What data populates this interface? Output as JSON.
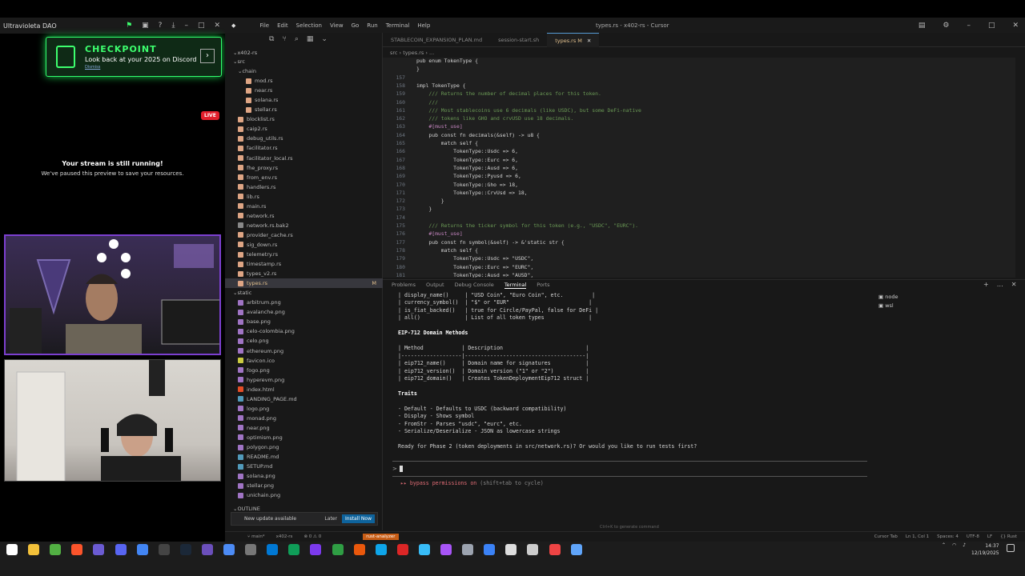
{
  "stream": {
    "window_title": "Ultravioleta DAO",
    "banner_title": "CHECKPOINT",
    "banner_text": "Look back at your 2025 on Discord",
    "banner_dismiss": "Dismiss",
    "live": "LIVE",
    "paused_title": "Your stream is still running!",
    "paused_sub": "We've paused this preview to save your resources."
  },
  "editor": {
    "title": "types.rs - x402-rs - Cursor",
    "menu": [
      "File",
      "Edit",
      "Selection",
      "View",
      "Go",
      "Run",
      "Terminal",
      "Help"
    ],
    "tabs": [
      "STABLECOIN_EXPANSION_PLAN.md",
      "session-start.sh",
      "types.rs M"
    ],
    "breadcrumb": "src  ›  types.rs  ›  ..."
  },
  "explorer": {
    "root": "x402-rs",
    "src": "src",
    "chain": "chain",
    "chain_files": [
      "mod.rs",
      "near.rs",
      "solana.rs",
      "stellar.rs"
    ],
    "files": [
      "blocklist.rs",
      "caip2.rs",
      "debug_utils.rs",
      "facilitator.rs",
      "facilitator_local.rs",
      "fhe_proxy.rs",
      "from_env.rs",
      "handlers.rs",
      "lib.rs",
      "main.rs",
      "network.rs",
      "network.rs.bak2",
      "provider_cache.rs",
      "sig_down.rs",
      "telemetry.rs",
      "timestamp.rs",
      "types_v2.rs",
      "types.rs"
    ],
    "static": "static",
    "static_files": [
      "arbitrum.png",
      "avalanche.png",
      "base.png",
      "celo-colombia.png",
      "celo.png",
      "ethereum.png",
      "favicon.ico",
      "fogo.png",
      "hyperevm.png",
      "index.html",
      "LANDING_PAGE.md",
      "logo.png",
      "monad.png",
      "near.png",
      "optimism.png",
      "polygon.png",
      "README.md",
      "SETUP.md",
      "solana.png",
      "stellar.png",
      "unichain.png"
    ],
    "outline": "OUTLINE",
    "modified_mark": "M"
  },
  "code": {
    "lines": [
      {
        "n": "",
        "t": "pub enum TokenType {"
      },
      {
        "n": "",
        "t": "}"
      },
      {
        "n": "157",
        "t": ""
      },
      {
        "n": "158",
        "t": "impl TokenType {"
      },
      {
        "n": "159",
        "t": "    /// Returns the number of decimal places for this token."
      },
      {
        "n": "160",
        "t": "    ///"
      },
      {
        "n": "161",
        "t": "    /// Most stablecoins use 6 decimals (like USDC), but some DeFi-native"
      },
      {
        "n": "162",
        "t": "    /// tokens like GHO and crvUSD use 18 decimals."
      },
      {
        "n": "163",
        "t": "    #[must_use]"
      },
      {
        "n": "164",
        "t": "    pub const fn decimals(&self) -> u8 {"
      },
      {
        "n": "165",
        "t": "        match self {"
      },
      {
        "n": "166",
        "t": "            TokenType::Usdc => 6,"
      },
      {
        "n": "167",
        "t": "            TokenType::Eurc => 6,"
      },
      {
        "n": "168",
        "t": "            TokenType::Ausd => 6,"
      },
      {
        "n": "169",
        "t": "            TokenType::Pyusd => 6,"
      },
      {
        "n": "170",
        "t": "            TokenType::Gho => 18,"
      },
      {
        "n": "171",
        "t": "            TokenType::CrvUsd => 18,"
      },
      {
        "n": "172",
        "t": "        }"
      },
      {
        "n": "173",
        "t": "    }"
      },
      {
        "n": "174",
        "t": ""
      },
      {
        "n": "175",
        "t": "    /// Returns the ticker symbol for this token (e.g., \"USDC\", \"EURC\")."
      },
      {
        "n": "176",
        "t": "    #[must_use]"
      },
      {
        "n": "177",
        "t": "    pub const fn symbol(&self) -> &'static str {"
      },
      {
        "n": "178",
        "t": "        match self {"
      },
      {
        "n": "179",
        "t": "            TokenType::Usdc => \"USDC\","
      },
      {
        "n": "180",
        "t": "            TokenType::Eurc => \"EURC\","
      },
      {
        "n": "181",
        "t": "            TokenType::Ausd => \"AUSD\","
      }
    ]
  },
  "panel": {
    "tabs": [
      "Problems",
      "Output",
      "Debug Console",
      "Terminal",
      "Ports"
    ],
    "sessions": [
      "node",
      "wsl"
    ],
    "term": [
      {
        "t": "| display_name()     | \"USD Coin\", \"Euro Coin\", etc.         |",
        "b": false
      },
      {
        "t": "| currency_symbol()  | \"$\" or \"EUR\"                         |",
        "b": false
      },
      {
        "t": "| is_fiat_backed()   | true for Circle/PayPal, false for DeFi |",
        "b": false
      },
      {
        "t": "| all()              | List of all token types              |",
        "b": false
      },
      {
        "t": "",
        "b": false
      },
      {
        "t": "EIP-712 Domain Methods",
        "b": true
      },
      {
        "t": "",
        "b": false
      },
      {
        "t": "| Method            | Description                          |",
        "b": false
      },
      {
        "t": "|-------------------|--------------------------------------|",
        "b": false
      },
      {
        "t": "| eip712_name()     | Domain name for signatures           |",
        "b": false
      },
      {
        "t": "| eip712_version()  | Domain version (\"1\" or \"2\")          |",
        "b": false
      },
      {
        "t": "| eip712_domain()   | Creates TokenDeploymentEip712 struct |",
        "b": false
      },
      {
        "t": "",
        "b": false
      },
      {
        "t": "Traits",
        "b": true
      },
      {
        "t": "",
        "b": false
      },
      {
        "t": "- Default - Defaults to USDC (backward compatibility)",
        "b": false
      },
      {
        "t": "- Display - Shows symbol",
        "b": false
      },
      {
        "t": "- FromStr - Parses \"usdc\", \"eurc\", etc.",
        "b": false
      },
      {
        "t": "- Serialize/Deserialize - JSON as lowercase strings",
        "b": false
      },
      {
        "t": "",
        "b": false
      },
      {
        "t": "Ready for Phase 2 (token deployments in src/network.rs)? Or would you like to run tests first?",
        "b": false
      }
    ],
    "prompt": ">",
    "bypass": "▸▸ bypass permissions on",
    "bypass_hint": "(shift+tab to cycle)",
    "gen_hint": "Ctrl+K to generate command"
  },
  "update": {
    "text": "New update available",
    "later": "Later",
    "install": "Install Now"
  },
  "status": {
    "branch": "main*",
    "repo": "x402-rs",
    "problems": "⊗ 0 ⚠ 0",
    "analyzer": "rust-analyzer",
    "right": [
      "Cursor Tab",
      "Ln 1, Col 1",
      "Spaces: 4",
      "UTF-8",
      "LF",
      "{} Rust"
    ]
  },
  "clock": {
    "time": "14:37",
    "date": "12/19/2025"
  }
}
